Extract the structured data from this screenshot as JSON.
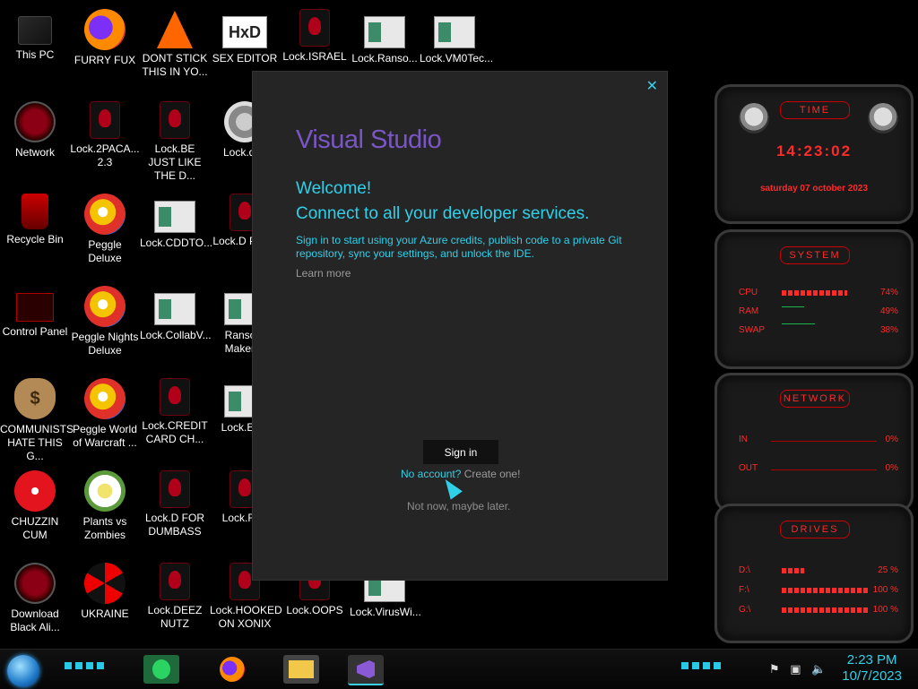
{
  "desktop": {
    "icons": [
      {
        "label": "This PC",
        "icon": "computer-icon"
      },
      {
        "label": "FURRY FUX",
        "icon": "firefox-icon"
      },
      {
        "label": "DONT STICK THIS IN YO...",
        "icon": "vlc-cone-icon"
      },
      {
        "label": "SEX EDITOR",
        "icon": "hxd-editor-icon"
      },
      {
        "label": "Lock.ISRAEL",
        "icon": "alien-lock-icon"
      },
      {
        "label": "Lock.Ranso...",
        "icon": "window-app-icon"
      },
      {
        "label": "Lock.VM0Tec...",
        "icon": "window-app-icon"
      },
      {
        "label": "Network",
        "icon": "alien-globe-icon"
      },
      {
        "label": "Lock.2PACA... 2.3",
        "icon": "alien-lock-icon"
      },
      {
        "label": "Lock.BE JUST LIKE THE D...",
        "icon": "alien-lock-icon"
      },
      {
        "label": "Lock.des",
        "icon": "gear-icon"
      },
      {
        "label": "Recycle Bin",
        "icon": "recycle-bin-icon"
      },
      {
        "label": "Peggle Deluxe",
        "icon": "peggle-icon"
      },
      {
        "label": "Lock.CDDTO...",
        "icon": "window-app-icon"
      },
      {
        "label": "Lock.D PLEA",
        "icon": "alien-lock-icon"
      },
      {
        "label": "Control Panel",
        "icon": "control-panel-icon"
      },
      {
        "label": "Peggle Nights Deluxe",
        "icon": "peggle-icon"
      },
      {
        "label": "Lock.CollabV...",
        "icon": "window-app-icon"
      },
      {
        "label": "Ransom Maker B",
        "icon": "window-app-icon"
      },
      {
        "label": "COMMUNISTS HATE THIS G...",
        "icon": "money-bag-icon"
      },
      {
        "label": "Peggle World of Warcraft ...",
        "icon": "peggle-icon"
      },
      {
        "label": "Lock.CREDIT CARD CH...",
        "icon": "alien-lock-icon"
      },
      {
        "label": "Lock.EFC",
        "icon": "window-app-icon"
      },
      {
        "label": "CHUZZIN CUM",
        "icon": "chuzzle-icon"
      },
      {
        "label": "Plants vs Zombies",
        "icon": "plants-vs-zombies-icon"
      },
      {
        "label": "Lock.D FOR DUMBASS",
        "icon": "alien-lock-icon"
      },
      {
        "label": "Lock.FLA",
        "icon": "alien-lock-icon"
      },
      {
        "label": "Download Black Ali...",
        "icon": "alien-globe-icon"
      },
      {
        "label": "UKRAINE",
        "icon": "radiation-icon"
      },
      {
        "label": "Lock.DEEZ NUTZ",
        "icon": "alien-lock-icon"
      },
      {
        "label": "Lock.HOOKED ON XONIX",
        "icon": "alien-lock-icon"
      },
      {
        "label": "Lock.OOPS",
        "icon": "alien-lock-icon"
      },
      {
        "label": "Lock.VirusWi...",
        "icon": "window-app-icon"
      }
    ]
  },
  "dialog": {
    "logo": "Visual Studio",
    "welcome": "Welcome!",
    "connect": "Connect to all your developer services.",
    "description": "Sign in to start using your Azure credits, publish code to a private Git repository, sync your settings, and unlock the IDE.",
    "learn_more": "Learn more",
    "sign_in": "Sign in",
    "no_account": "No account?",
    "create_one": "Create one!",
    "not_now": "Not now, maybe later.",
    "close": "✕"
  },
  "gadgets": {
    "time": {
      "title": "TIME",
      "clock": "14:23:02",
      "date": "saturday 07 october 2023"
    },
    "system": {
      "title": "SYSTEM",
      "rows": [
        {
          "label": "CPU",
          "value": "74%",
          "fraction": 0.74
        },
        {
          "label": "RAM",
          "value": "49%",
          "fraction": 0.49
        },
        {
          "label": "SWAP",
          "value": "38%",
          "fraction": 0.38
        }
      ]
    },
    "network": {
      "title": "NETWORK",
      "rows": [
        {
          "label": "IN",
          "value": "0%"
        },
        {
          "label": "OUT",
          "value": "0%"
        }
      ]
    },
    "drives": {
      "title": "DRIVES",
      "rows": [
        {
          "label": "D:\\",
          "value": "25 %",
          "fraction": 0.25
        },
        {
          "label": "F:\\",
          "value": "100 %",
          "fraction": 1.0
        },
        {
          "label": "G:\\",
          "value": "100 %",
          "fraction": 1.0
        }
      ]
    }
  },
  "taskbar": {
    "apps": [
      "sticky-notes-icon",
      "firefox-icon",
      "file-explorer-icon",
      "visual-studio-icon"
    ],
    "tray_icons": [
      "action-center-flag-icon",
      "network-icon",
      "volume-icon"
    ],
    "time": "2:23 PM",
    "date": "10/7/2023"
  },
  "colors": {
    "accent": "#2fd0e8",
    "vs_purple": "#7a56c4",
    "gadget_red": "#ff2a2a"
  }
}
